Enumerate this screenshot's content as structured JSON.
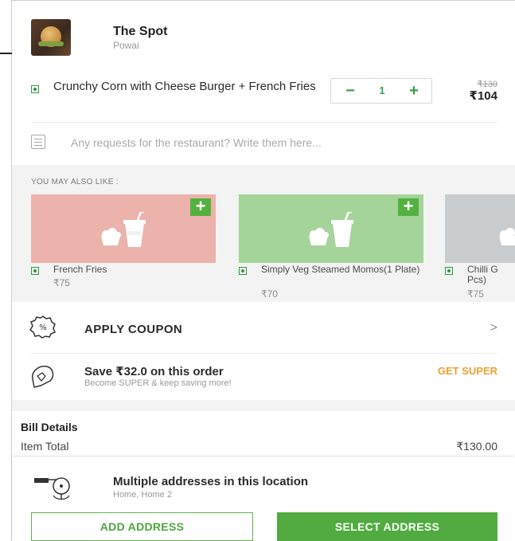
{
  "restaurant": {
    "name": "The Spot",
    "area": "Powai"
  },
  "cart_item": {
    "name": "Crunchy Corn with Cheese Burger + French Fries",
    "quantity": "1",
    "minus_symbol": "−",
    "plus_symbol": "+",
    "price_original": "₹130",
    "price_final": "₹104",
    "veg_icon": "veg-indicator-icon"
  },
  "requests": {
    "placeholder": "Any requests for the restaurant? Write them here...",
    "icon": "note-list-icon"
  },
  "recommendations": {
    "title": "YOU MAY ALSO LIKE :",
    "add_symbol": "+",
    "items": [
      {
        "name": "French Fries",
        "price": "₹75",
        "color": "#ebb3ab"
      },
      {
        "name": "Simply Veg Steamed Momos(1 Plate)",
        "price": "₹70",
        "color": "#a4d49a"
      },
      {
        "name": "Chilli G Pcs)",
        "price": "₹75",
        "color": "#c9ccce"
      }
    ]
  },
  "coupon": {
    "label": "APPLY COUPON",
    "chevron": ">",
    "icon": "coupon-percent-icon"
  },
  "super": {
    "title": "Save ₹32.0 on this order",
    "subtitle": "Become SUPER & keep saving more!",
    "cta": "GET SUPER",
    "icon": "super-badge-icon",
    "cta_color": "#e8a332"
  },
  "bill": {
    "title": "Bill Details",
    "item_total_label": "Item Total",
    "item_total_value": "₹130.00"
  },
  "address": {
    "title": "Multiple addresses in this location",
    "subtitle": "Home, Home 2",
    "add_button": "ADD ADDRESS",
    "select_button": "SELECT ADDRESS",
    "icon": "location-pin-icon",
    "accent_color": "#51ab40"
  }
}
